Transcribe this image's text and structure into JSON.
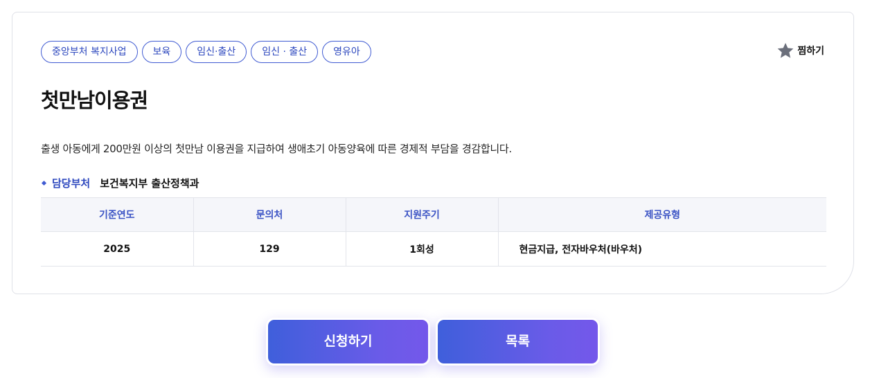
{
  "tags": [
    "중앙부처 복지사업",
    "보육",
    "임신·출산",
    "임신 · 출산",
    "영유아"
  ],
  "favorite": {
    "label": "찜하기",
    "icon": "star-icon"
  },
  "title": "첫만남이용권",
  "description": "출생 아동에게 200만원 이상의 첫만남 이용권을 지급하여 생애초기 아동양육에 따른 경제적 부담을 경감합니다.",
  "department": {
    "label": "담당부처",
    "value": "보건복지부 출산정책과"
  },
  "table": {
    "headers": [
      "기준연도",
      "문의처",
      "지원주기",
      "제공유형"
    ],
    "row": [
      "2025",
      "129",
      "1회성",
      "현금지급, 전자바우처(바우처)"
    ]
  },
  "buttons": {
    "apply": "신청하기",
    "list": "목록"
  },
  "colors": {
    "accent": "#3f5ad2",
    "gradient_start": "#3f5fdb",
    "gradient_end": "#7458ea",
    "table_header_bg": "#f5f6fa"
  }
}
